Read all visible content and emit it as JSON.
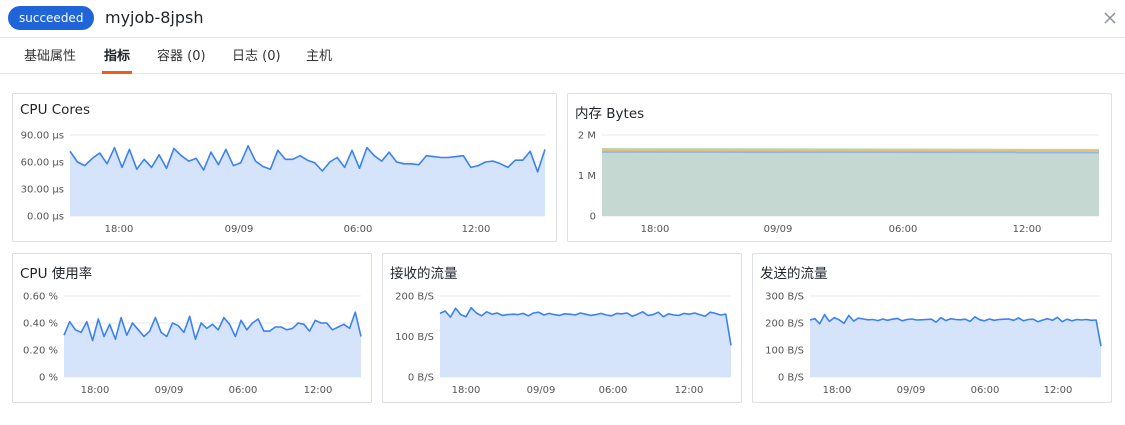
{
  "header": {
    "status": "succeeded",
    "title": "myjob-8jpsh",
    "close_icon": "close-icon"
  },
  "tabs": [
    {
      "label": "基础属性",
      "active": false
    },
    {
      "label": "指标",
      "active": true
    },
    {
      "label": "容器 (0)",
      "active": false
    },
    {
      "label": "日志 (0)",
      "active": false
    },
    {
      "label": "主机",
      "active": false
    }
  ],
  "colors": {
    "accent": "#f35b1b",
    "badge": "#1f64d8",
    "line": "#3b82f0",
    "fill": "#d6e4fb",
    "grid": "#e8e8e8"
  },
  "chart_data": [
    {
      "id": "cpu-cores",
      "type": "area",
      "title": "CPU Cores",
      "x_ticks": [
        "18:00",
        "09/09",
        "06:00",
        "12:00"
      ],
      "y_ticks": [
        "0.00 µs",
        "30.00 µs",
        "60.00 µs",
        "90.00 µs"
      ],
      "ylim": [
        0,
        90
      ],
      "series": [
        {
          "values": [
            72,
            60,
            56,
            64,
            70,
            58,
            76,
            54,
            74,
            52,
            63,
            54,
            68,
            53,
            75,
            67,
            61,
            64,
            51,
            71,
            57,
            74,
            56,
            59,
            78,
            61,
            55,
            52,
            73,
            63,
            63,
            67,
            62,
            59,
            50,
            60,
            65,
            54,
            73,
            53,
            76,
            67,
            61,
            71,
            60,
            58,
            58,
            57,
            67,
            66,
            65,
            65,
            66,
            67,
            54,
            56,
            60,
            61,
            58,
            54,
            62,
            62,
            72,
            49,
            74
          ]
        }
      ]
    },
    {
      "id": "memory",
      "type": "area",
      "title": "内存 Bytes",
      "x_ticks": [
        "18:00",
        "09/09",
        "06:00",
        "12:00"
      ],
      "y_ticks": [
        "0",
        "1 M",
        "2 M"
      ],
      "ylim": [
        0,
        2
      ],
      "series": [
        {
          "color": "#b8d6b4",
          "values": [
            1.66,
            1.64
          ]
        },
        {
          "color": "#e8c06c",
          "values": [
            1.62,
            1.61
          ]
        },
        {
          "color": "#8fb6ec",
          "values": [
            1.58,
            1.57
          ]
        },
        {
          "color": "#c5d8d2",
          "values": [
            1.54,
            1.53
          ]
        }
      ]
    },
    {
      "id": "cpu-usage",
      "type": "area",
      "title": "CPU 使用率",
      "x_ticks": [
        "18:00",
        "09/09",
        "06:00",
        "12:00"
      ],
      "y_ticks": [
        "0 %",
        "0.20 %",
        "0.40 %",
        "0.60 %"
      ],
      "ylim": [
        0,
        0.6
      ],
      "series": [
        {
          "values": [
            0.31,
            0.41,
            0.35,
            0.33,
            0.41,
            0.27,
            0.43,
            0.3,
            0.39,
            0.28,
            0.44,
            0.31,
            0.4,
            0.35,
            0.3,
            0.34,
            0.44,
            0.33,
            0.3,
            0.4,
            0.38,
            0.33,
            0.45,
            0.28,
            0.4,
            0.36,
            0.39,
            0.35,
            0.44,
            0.39,
            0.3,
            0.42,
            0.35,
            0.4,
            0.43,
            0.34,
            0.34,
            0.37,
            0.37,
            0.35,
            0.36,
            0.4,
            0.39,
            0.34,
            0.42,
            0.4,
            0.4,
            0.35,
            0.37,
            0.39,
            0.36,
            0.48,
            0.3
          ]
        }
      ]
    },
    {
      "id": "rx",
      "type": "area",
      "title": "接收的流量",
      "x_ticks": [
        "18:00",
        "09/09",
        "06:00",
        "12:00"
      ],
      "y_ticks": [
        "0 B/S",
        "100 B/S",
        "200 B/S"
      ],
      "ylim": [
        0,
        200
      ],
      "series": [
        {
          "values": [
            157,
            163,
            148,
            170,
            154,
            149,
            171,
            158,
            151,
            161,
            155,
            158,
            152,
            154,
            155,
            154,
            157,
            151,
            158,
            160,
            153,
            157,
            154,
            152,
            156,
            155,
            153,
            158,
            155,
            152,
            154,
            157,
            153,
            151,
            157,
            156,
            158,
            150,
            155,
            161,
            152,
            154,
            160,
            149,
            156,
            153,
            152,
            157,
            155,
            158,
            154,
            150,
            160,
            157,
            153,
            155,
            78
          ]
        }
      ]
    },
    {
      "id": "tx",
      "type": "area",
      "title": "发送的流量",
      "x_ticks": [
        "18:00",
        "09/09",
        "06:00",
        "12:00"
      ],
      "y_ticks": [
        "0 B/S",
        "100 B/S",
        "200 B/S",
        "300 B/S"
      ],
      "ylim": [
        0,
        300
      ],
      "series": [
        {
          "values": [
            211,
            216,
            197,
            231,
            206,
            220,
            212,
            199,
            228,
            207,
            218,
            215,
            212,
            213,
            209,
            215,
            210,
            214,
            217,
            208,
            213,
            215,
            211,
            212,
            213,
            214,
            203,
            220,
            209,
            216,
            213,
            212,
            214,
            206,
            223,
            212,
            208,
            215,
            210,
            213,
            214,
            215,
            210,
            219,
            208,
            213,
            214,
            205,
            211,
            216,
            210,
            221,
            205,
            214,
            208,
            213,
            211,
            213,
            210,
            211,
            114
          ]
        }
      ]
    }
  ]
}
